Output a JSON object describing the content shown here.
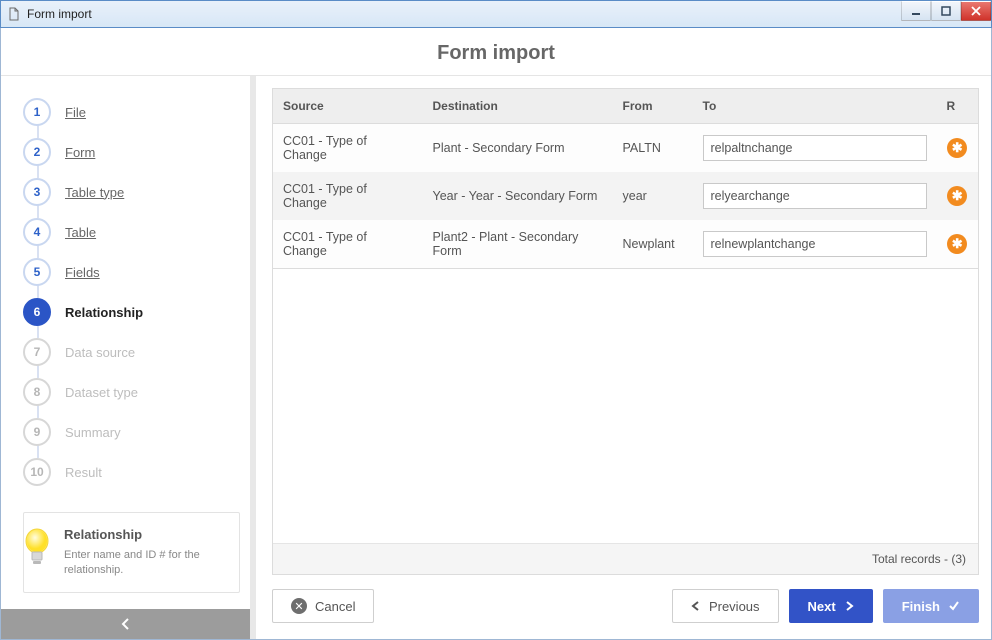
{
  "window": {
    "title": "Form import"
  },
  "header": {
    "title": "Form import"
  },
  "sidebar": {
    "steps": [
      {
        "num": "1",
        "label": "File",
        "state": "done"
      },
      {
        "num": "2",
        "label": "Form",
        "state": "done"
      },
      {
        "num": "3",
        "label": "Table type",
        "state": "done"
      },
      {
        "num": "4",
        "label": "Table",
        "state": "done"
      },
      {
        "num": "5",
        "label": "Fields",
        "state": "done"
      },
      {
        "num": "6",
        "label": "Relationship",
        "state": "current"
      },
      {
        "num": "7",
        "label": "Data source",
        "state": "pending"
      },
      {
        "num": "8",
        "label": "Dataset type",
        "state": "pending"
      },
      {
        "num": "9",
        "label": "Summary",
        "state": "pending"
      },
      {
        "num": "10",
        "label": "Result",
        "state": "pending"
      }
    ],
    "help": {
      "title": "Relationship",
      "body": "Enter name and ID # for the relationship."
    }
  },
  "grid": {
    "columns": {
      "source": "Source",
      "destination": "Destination",
      "from": "From",
      "to": "To",
      "r": "R"
    },
    "rows": [
      {
        "source": "CC01 - Type of Change",
        "destination": "Plant - Secondary Form",
        "from": "PALTN",
        "to": "relpaltnchange",
        "r": "✱"
      },
      {
        "source": "CC01 - Type of Change",
        "destination": "Year - Year - Secondary Form",
        "from": "year",
        "to": "relyearchange",
        "r": "✱"
      },
      {
        "source": "CC01 - Type of Change",
        "destination": "Plant2 - Plant - Secondary Form",
        "from": "Newplant",
        "to": "relnewplantchange",
        "r": "✱"
      }
    ],
    "footer": {
      "label": "Total records  -",
      "count": "(3)"
    }
  },
  "buttons": {
    "cancel": "Cancel",
    "previous": "Previous",
    "next": "Next",
    "finish": "Finish"
  }
}
